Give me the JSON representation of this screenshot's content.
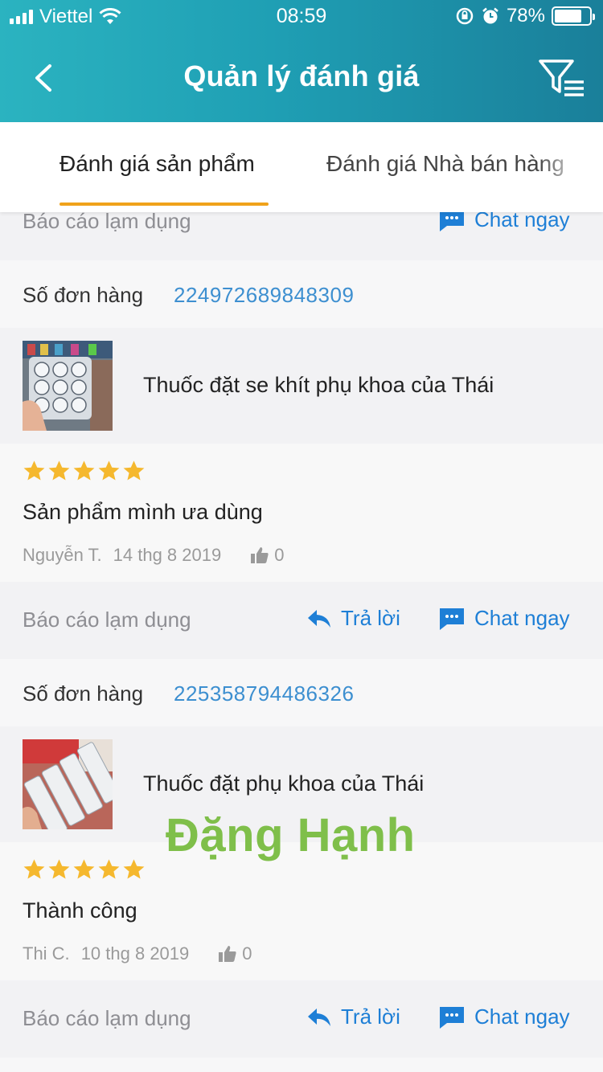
{
  "status_bar": {
    "carrier": "Viettel",
    "time": "08:59",
    "battery": "78%",
    "battery_level": 0.78
  },
  "nav": {
    "title": "Quản lý đánh giá"
  },
  "tabs": [
    {
      "label": "Đánh giá sản phẩm",
      "active": true
    },
    {
      "label": "Đánh giá Nhà bán hàng",
      "active": false
    }
  ],
  "top_partial": {
    "report_label": "Báo cáo lạm dụng",
    "chat_label": "Chat ngay"
  },
  "reviews": [
    {
      "order_label": "Số đơn hàng",
      "order_number": "224972689848309",
      "product_name": "Thuốc đặt se khít phụ khoa của Thái",
      "rating": 5,
      "text": "Sản phẩm mình ưa dùng",
      "author": "Nguyễn T.",
      "date": "14 thg 8 2019",
      "likes": "0",
      "report_label": "Báo cáo lạm dụng",
      "reply_label": "Trả lời",
      "chat_label": "Chat ngay"
    },
    {
      "order_label": "Số đơn hàng",
      "order_number": "225358794486326",
      "product_name": "Thuốc đặt phụ khoa của Thái",
      "rating": 5,
      "text": "Thành công",
      "author": "Thi C.",
      "date": "10 thg 8 2019",
      "likes": "0",
      "report_label": "Báo cáo lạm dụng",
      "reply_label": "Trả lời",
      "chat_label": "Chat ngay"
    }
  ],
  "watermark": "Đặng Hạnh",
  "colors": {
    "header_start": "#2bb3c0",
    "header_end": "#1a7f9a",
    "tab_indicator": "#f0a21a",
    "link_blue": "#1e7fd6",
    "star": "#f5b82e",
    "watermark": "#7fbf4a"
  }
}
